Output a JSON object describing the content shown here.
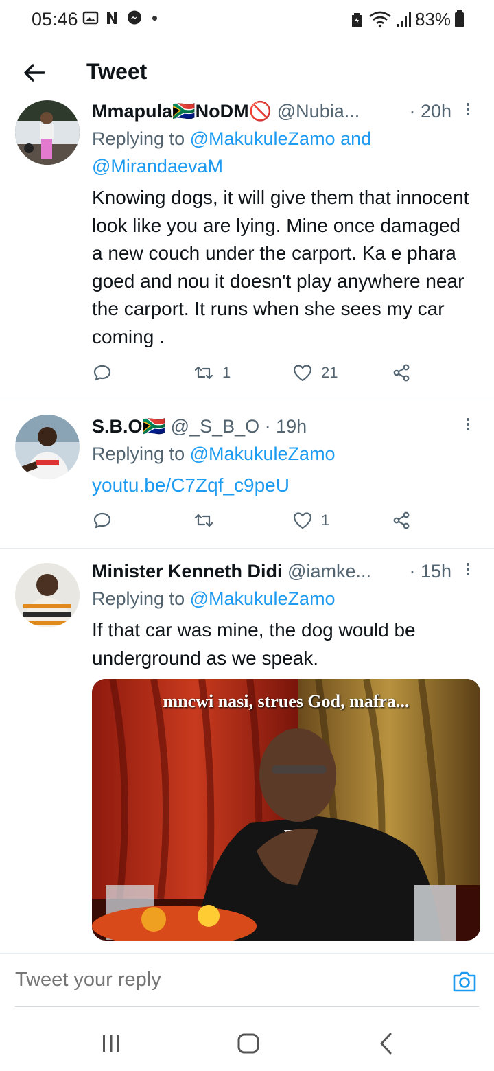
{
  "status_bar": {
    "time": "05:46",
    "battery": "83%",
    "icons": [
      "gallery-icon",
      "netflix-icon",
      "messenger-icon",
      "dot-icon",
      "battery-saver-icon",
      "wifi-icon",
      "signal-icon",
      "battery-icon"
    ]
  },
  "header": {
    "title": "Tweet",
    "back_icon": "arrow-left-icon"
  },
  "tweets": [
    {
      "name": "Mmapula🇿🇦NoDM🚫",
      "handle": "@Nubia...",
      "time": "· 20h",
      "replying_prefix": "Replying to ",
      "replying_to_1": "@MakukuleZamo",
      "replying_and": " and",
      "replying_to_2": "@MirandaevaM",
      "text": "Knowing dogs, it will give them that innocent look like you are lying. Mine once damaged a new couch under the carport. Ka e phara goed and nou it doesn't play anywhere near the carport. It runs when she sees my car coming .",
      "retweets": "1",
      "likes": "21"
    },
    {
      "name": "S.B.O🇿🇦",
      "handle": "@_S_B_O",
      "time": "· 19h",
      "replying_prefix": "Replying to ",
      "replying_to_1": "@MakukuleZamo",
      "link": "youtu.be/C7Zqf_c9peU",
      "retweets": "",
      "likes": "1"
    },
    {
      "name": "Minister Kenneth Didi",
      "handle": "@iamke...",
      "time": "· 15h",
      "replying_prefix": "Replying to ",
      "replying_to_1": "@MakukuleZamo",
      "text": "If that car was mine, the dog would be underground as we speak.",
      "media_caption": "mncwi nasi, strues God, mafra..."
    }
  ],
  "reply_bar": {
    "placeholder": "Tweet your reply",
    "camera_icon": "camera-icon"
  },
  "nav_bar": {
    "icons": [
      "recent-apps-icon",
      "home-icon",
      "back-icon"
    ]
  },
  "colors": {
    "accent": "#1d9bf0",
    "secondary_text": "#536471",
    "primary_text": "#0f1419",
    "divider": "#e6ecf0"
  }
}
